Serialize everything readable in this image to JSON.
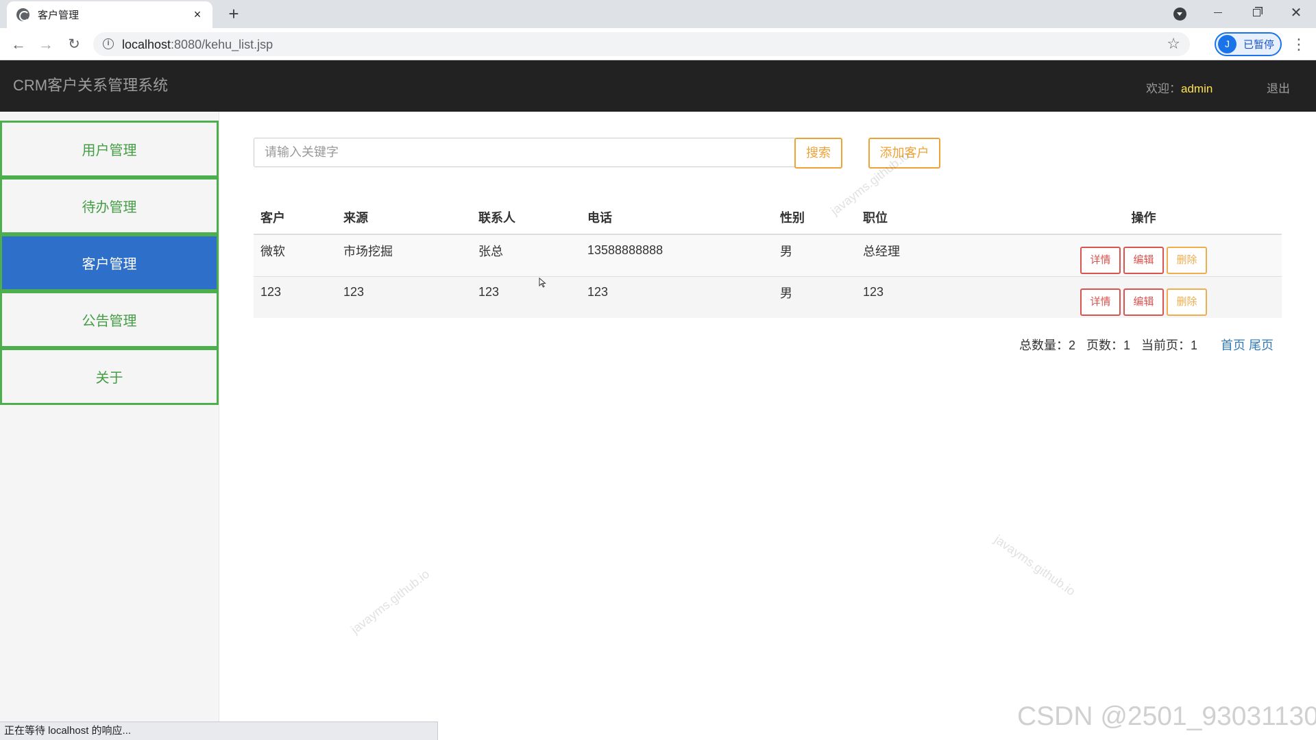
{
  "browser": {
    "tab_title": "客户管理",
    "tab_close": "×",
    "new_tab": "+",
    "url_host": "localhost",
    "url_rest": ":8080/kehu_list.jsp",
    "profile_initial": "J",
    "profile_label": "已暂停",
    "status_text": "正在等待 localhost 的响应..."
  },
  "header": {
    "brand": "CRM客户关系管理系统",
    "welcome_label": "欢迎：",
    "username": "admin",
    "logout": "退出"
  },
  "sidebar": {
    "items": [
      {
        "label": "用户管理",
        "active": false
      },
      {
        "label": "待办管理",
        "active": false
      },
      {
        "label": "客户管理",
        "active": true
      },
      {
        "label": "公告管理",
        "active": false
      },
      {
        "label": "关于",
        "active": false
      }
    ]
  },
  "toolbar": {
    "search_placeholder": "请输入关键字",
    "search_button": "搜索",
    "add_button": "添加客户"
  },
  "table": {
    "columns": [
      "客户",
      "来源",
      "联系人",
      "电话",
      "性别",
      "职位",
      "操作"
    ],
    "rows": [
      [
        "微软",
        "市场挖掘",
        "张总",
        "13588888888",
        "男",
        "总经理"
      ],
      [
        "123",
        "123",
        "123",
        "123",
        "男",
        "123"
      ]
    ],
    "actions": {
      "detail": "详情",
      "edit": "编辑",
      "delete": "删除"
    }
  },
  "pager": {
    "total_label": "总数量：2",
    "pages_label": "页数：1",
    "current_label": "当前页：1",
    "first": "首页",
    "last": "尾页"
  },
  "watermarks": {
    "site": "javayms.github.io",
    "csdn": "CSDN @2501_93031130"
  },
  "colors": {
    "header_bg": "#222222",
    "sidebar_border": "#4cae4c",
    "sidebar_active_bg": "#2e6fc9",
    "warning": "#eea236",
    "danger": "#d9534f",
    "username": "#ffe44d"
  }
}
